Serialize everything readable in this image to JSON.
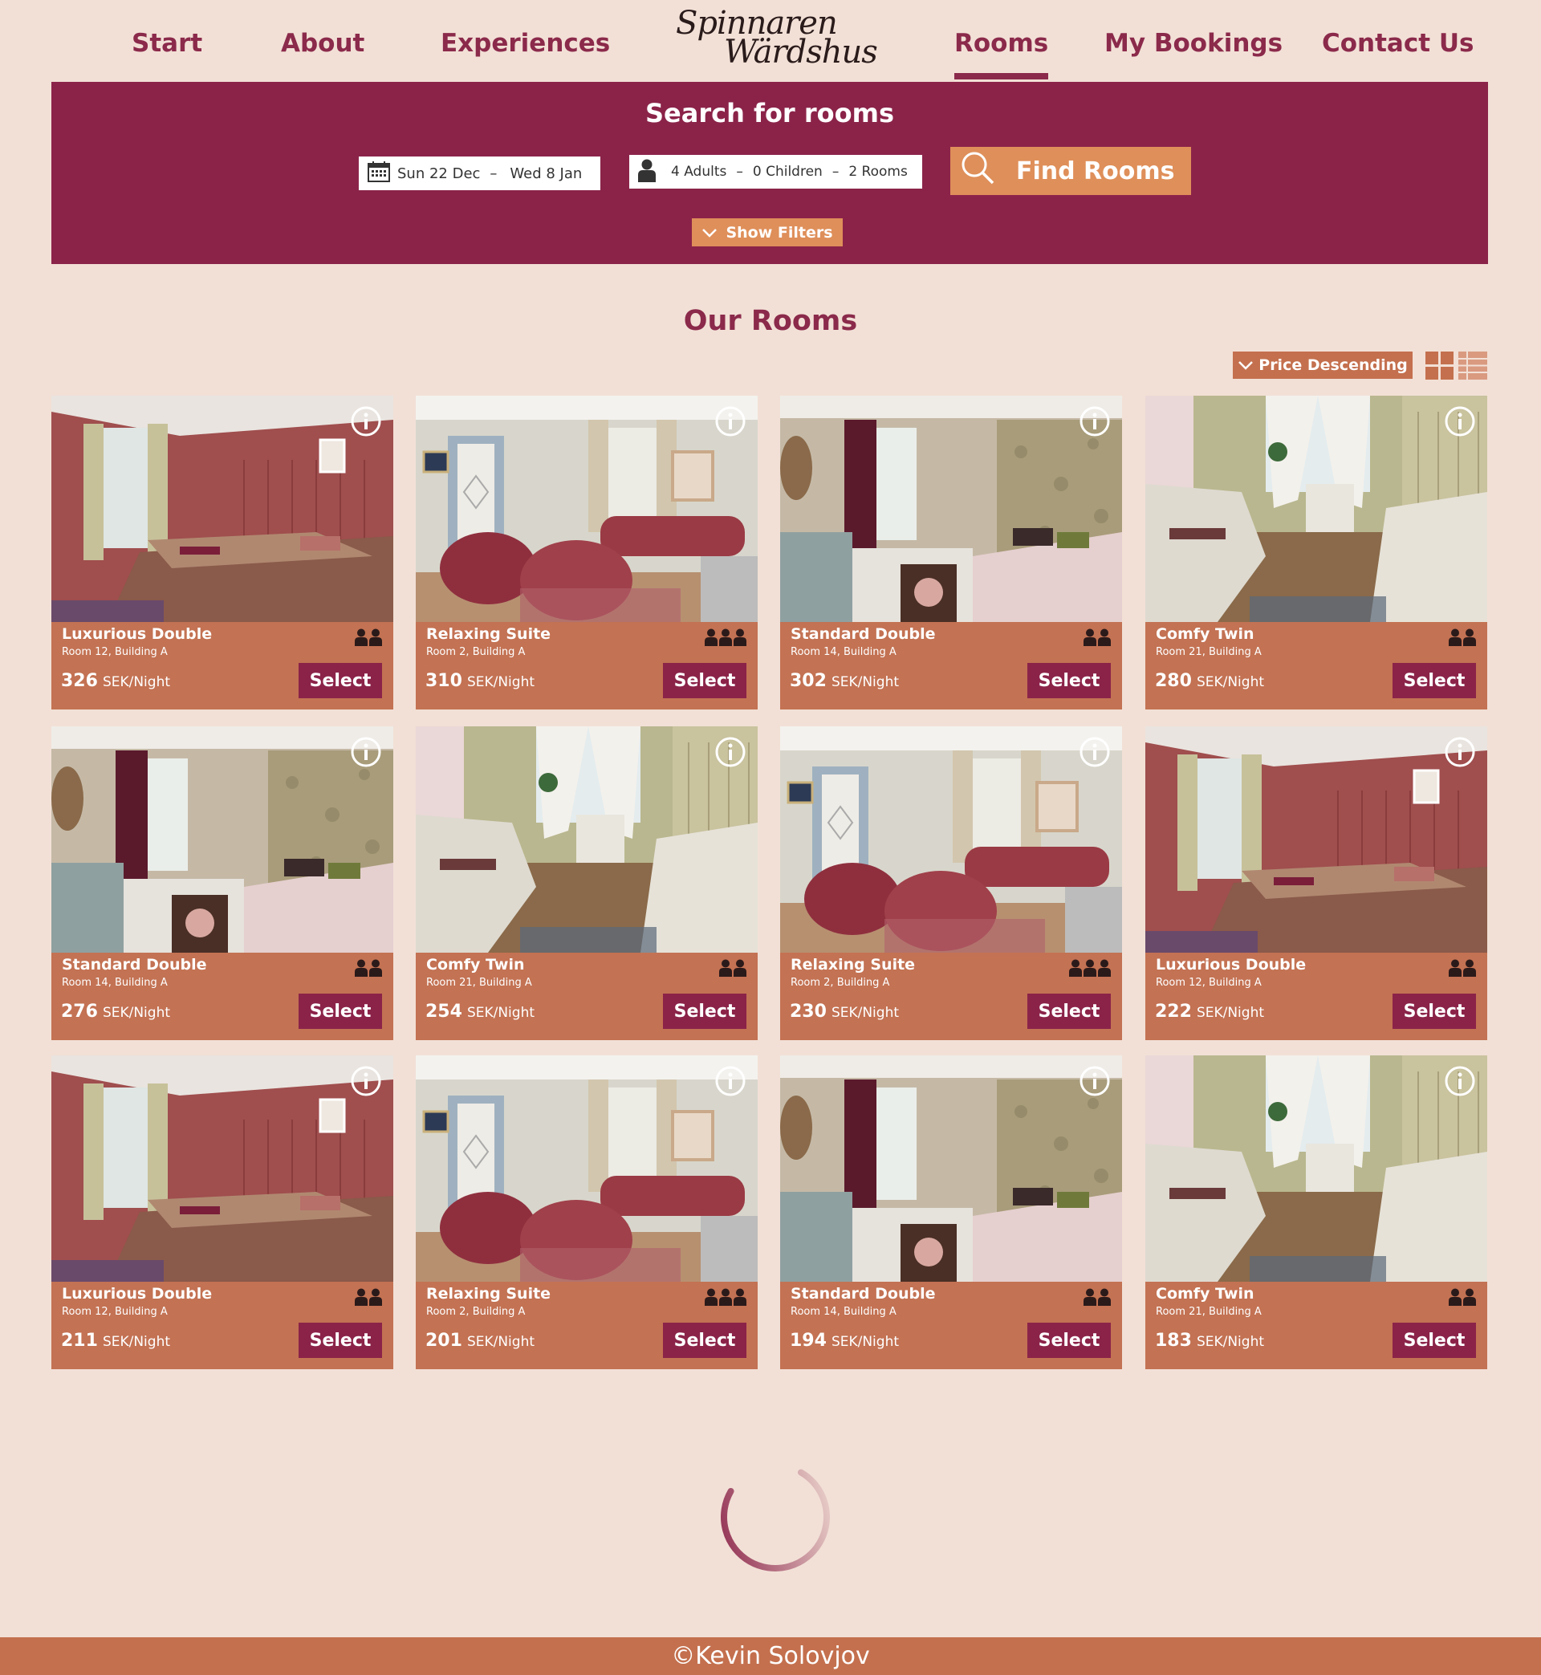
{
  "nav": {
    "items": [
      {
        "label": "Start"
      },
      {
        "label": "About"
      },
      {
        "label": "Experiences"
      },
      {
        "label": "Rooms"
      },
      {
        "label": "My Bookings"
      },
      {
        "label": "Contact Us"
      }
    ],
    "active": "Rooms",
    "logo_line1": "Spinnaren",
    "logo_line2": "Wärdshus"
  },
  "search": {
    "title": "Search for rooms",
    "date_from": "Sun 22 Dec",
    "date_to": "Wed 8 Jan",
    "adults": "4 Adults",
    "children": "0 Children",
    "rooms": "2 Rooms",
    "find_label": "Find Rooms",
    "filters_label": "Show Filters"
  },
  "main": {
    "title": "Our Rooms",
    "sort_label": "Price Descending"
  },
  "rooms": [
    {
      "name": "Luxurious Double",
      "location": "Room 12, Building A",
      "price": "326",
      "unit": "SEK/Night",
      "guests": 2,
      "select": "Select",
      "image": "red"
    },
    {
      "name": "Relaxing Suite",
      "location": "Room 2, Building A",
      "price": "310",
      "unit": "SEK/Night",
      "guests": 3,
      "select": "Select",
      "image": "suite"
    },
    {
      "name": "Standard Double",
      "location": "Room 14, Building A",
      "price": "302",
      "unit": "SEK/Night",
      "guests": 2,
      "select": "Select",
      "image": "standard"
    },
    {
      "name": "Comfy Twin",
      "location": "Room 21, Building A",
      "price": "280",
      "unit": "SEK/Night",
      "guests": 2,
      "select": "Select",
      "image": "twin"
    },
    {
      "name": "Standard Double",
      "location": "Room 14, Building A",
      "price": "276",
      "unit": "SEK/Night",
      "guests": 2,
      "select": "Select",
      "image": "standard"
    },
    {
      "name": "Comfy Twin",
      "location": "Room 21, Building A",
      "price": "254",
      "unit": "SEK/Night",
      "guests": 2,
      "select": "Select",
      "image": "twin"
    },
    {
      "name": "Relaxing Suite",
      "location": "Room 2, Building A",
      "price": "230",
      "unit": "SEK/Night",
      "guests": 3,
      "select": "Select",
      "image": "suite"
    },
    {
      "name": "Luxurious Double",
      "location": "Room 12, Building A",
      "price": "222",
      "unit": "SEK/Night",
      "guests": 2,
      "select": "Select",
      "image": "red"
    },
    {
      "name": "Luxurious Double",
      "location": "Room 12, Building A",
      "price": "211",
      "unit": "SEK/Night",
      "guests": 2,
      "select": "Select",
      "image": "red"
    },
    {
      "name": "Relaxing Suite",
      "location": "Room 2, Building A",
      "price": "201",
      "unit": "SEK/Night",
      "guests": 3,
      "select": "Select",
      "image": "suite"
    },
    {
      "name": "Standard Double",
      "location": "Room 14, Building A",
      "price": "194",
      "unit": "SEK/Night",
      "guests": 2,
      "select": "Select",
      "image": "standard"
    },
    {
      "name": "Comfy Twin",
      "location": "Room 21, Building A",
      "price": "183",
      "unit": "SEK/Night",
      "guests": 2,
      "select": "Select",
      "image": "twin"
    }
  ],
  "footer": {
    "text": "©Kevin Solovjov"
  },
  "colors": {
    "background": "#f2e0d6",
    "primary": "#8b2349",
    "accent": "#df8f5a",
    "card": "#c37253",
    "footer": "#c4704e"
  },
  "icons": [
    "calendar-icon",
    "person-icon",
    "search-icon",
    "chevron-down-icon",
    "info-icon",
    "guest-icon",
    "grid-view-icon",
    "list-view-icon",
    "loading-spinner-icon"
  ]
}
